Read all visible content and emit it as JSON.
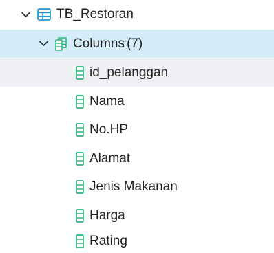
{
  "tree": {
    "table": {
      "icon": "table-icon",
      "label": "TB_Restoran",
      "expanded": true
    },
    "columns_node": {
      "icon": "columns-icon",
      "label": "Columns",
      "count": "(7)",
      "expanded": true
    },
    "columns": [
      {
        "label": "id_pelanggan",
        "icon": "column-icon",
        "selected": true
      },
      {
        "label": "Nama",
        "icon": "column-icon"
      },
      {
        "label": "No.HP",
        "icon": "column-icon"
      },
      {
        "label": "Alamat",
        "icon": "column-icon"
      },
      {
        "label": "Jenis Makanan",
        "icon": "column-icon"
      },
      {
        "label": "Harga",
        "icon": "column-icon"
      },
      {
        "label": "Rating",
        "icon": "column-icon"
      }
    ]
  },
  "colors": {
    "selected_parent_bg": "#d5edf8",
    "hover_bg": "#eef0f3",
    "icon_teal": "#2db87a",
    "icon_blue": "#1b9ad6"
  }
}
